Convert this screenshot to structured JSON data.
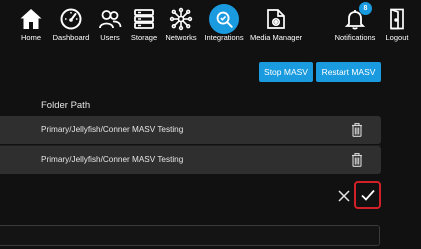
{
  "nav": {
    "items": [
      {
        "id": "home",
        "label": "Home",
        "icon": "home-icon"
      },
      {
        "id": "dashboard",
        "label": "Dashboard",
        "icon": "dashboard-gauge-icon"
      },
      {
        "id": "users",
        "label": "Users",
        "icon": "users-icon"
      },
      {
        "id": "storage",
        "label": "Storage",
        "icon": "storage-icon"
      },
      {
        "id": "networks",
        "label": "Networks",
        "icon": "network-icon"
      },
      {
        "id": "integrations",
        "label": "Integrations",
        "icon": "integrations-icon",
        "active": true
      },
      {
        "id": "media-manager",
        "label": "Media Manager",
        "icon": "media-manager-icon"
      },
      {
        "id": "notifications",
        "label": "Notifications",
        "icon": "bell-icon"
      },
      {
        "id": "logout",
        "label": "Logout",
        "icon": "logout-door-icon"
      }
    ],
    "notification_count": "8"
  },
  "actions": {
    "stop_label": "Stop MASV",
    "restart_label": "Restart MASV"
  },
  "table": {
    "header": "Folder Path",
    "rows": [
      {
        "path": "Primary/Jellyfish/Conner MASV Testing"
      },
      {
        "path": "Primary/Jellyfish/Conner MASV Testing"
      }
    ]
  },
  "colors": {
    "accent": "#1a9be0",
    "background": "#111111",
    "row": "#2f2f2f",
    "highlight": "#d12027"
  }
}
